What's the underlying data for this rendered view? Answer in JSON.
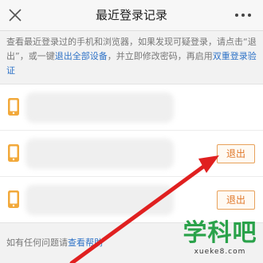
{
  "header": {
    "title": "最近登录记录",
    "back_icon": "close-icon",
    "more_icon": "more-dots-icon"
  },
  "notice": {
    "text_1": "查看最近登录过的手机和浏览器，如果发现可疑登录，请点击“退出”，或一键",
    "link_logout_all": "退出全部设备",
    "text_2": "，并立即修改密码，再启用",
    "link_two_step": "双重登录验证"
  },
  "devices": [
    {
      "icon": "phone-icon",
      "action_label": ""
    },
    {
      "icon": "phone-icon",
      "action_label": "退出"
    },
    {
      "icon": "phone-icon",
      "action_label": "退出"
    }
  ],
  "footer": {
    "help_text": "如有任何问题请",
    "help_link": "查看帮助"
  },
  "watermark": {
    "main": "学科吧",
    "sub": "xueke8.com"
  },
  "colors": {
    "accent_orange": "#e0782a",
    "link_blue": "#2f73c7",
    "phone_icon": "#f2a93b",
    "arrow_red": "#e02020",
    "watermark_green": "#2aa24a"
  }
}
